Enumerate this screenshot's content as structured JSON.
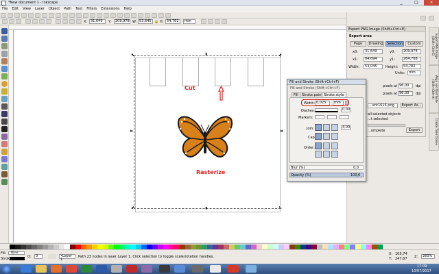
{
  "window": {
    "title": "*New document 1 - Inkscape",
    "minimize": "_",
    "maximize": "□",
    "close": "×"
  },
  "menu": [
    "File",
    "Edit",
    "View",
    "Layer",
    "Object",
    "Path",
    "Text",
    "Filters",
    "Extensions",
    "Help"
  ],
  "controls": {
    "x_label": "X:",
    "x_value": "31,649",
    "y_label": "Y:",
    "y_value": "209,978",
    "w_label": "W:",
    "w_value": "53,645",
    "h_label": "H:",
    "h_value": "54,762",
    "unit": "mm"
  },
  "canvas": {
    "cut_label": "Cut",
    "rasterize_label": "Rasterize",
    "cut_color": "#e02020"
  },
  "export_panel": {
    "title": "Export PNG Image (Shift+Ctrl+E)",
    "area_label": "Export area",
    "buttons": [
      "Page",
      "Drawing",
      "Selection",
      "Custom"
    ],
    "active_button": "Selection",
    "x0_label": "x0:",
    "x0": "31,649",
    "x1_label": "x1:",
    "x1": "84,694",
    "width_label": "Width:",
    "width": "53,045",
    "y0_label": "y0:",
    "y0": "209,978",
    "y1_label": "y1:",
    "y1": "264,768",
    "height_label": "Height:",
    "height": "54,782",
    "units_label": "Units:",
    "units": "mm",
    "dpi_label": "dpi",
    "pixels_at": "pixels at",
    "dpi_value_1": "96,00",
    "dpi_value_2": "96,00",
    "filename": "...ent1616.png",
    "export_as": "Export As...",
    "all_selected": "all selected objects",
    "hide_except": "...t selected",
    "complete": "...omplete",
    "export_button": "Export"
  },
  "fill_stroke": {
    "title": "Fill and Stroke (Shift+Ctrl+F)",
    "subtitle": "Fill and Stroke (Shift+Ctrl+F)",
    "tabs": [
      "Fill",
      "Stroke paint",
      "Stroke style"
    ],
    "active_tab": "Stroke style",
    "width_label": "Width:",
    "width_value": "0,025",
    "width_unit": "mm",
    "dashes_label": "Dashes:",
    "dashes_value": "0,00",
    "markers_label": "Markers:",
    "join_label": "Join:",
    "join_value": "4,00",
    "cap_label": "Cap:",
    "order_label": "Order:",
    "blur_label": "Blur (%)",
    "blur_value": "0,0",
    "opacity_label": "Opacity (%)",
    "opacity_value": "100,0",
    "highlight_color": "#e01010"
  },
  "status": {
    "fill_label": "Fill:",
    "stroke_label": "Stroke:",
    "fill_value": "None",
    "o_label": "O:",
    "o_value": "0",
    "layer": "•Layer 1",
    "message": "Path 23 nodes in layer Layer 1. Click selection to toggle scale/rotation handles.",
    "x_label": "X:",
    "x_coord": "105,74",
    "y_label": "Y:",
    "y_coord": "247,67",
    "z_label": "Z:",
    "zoom": "260%"
  },
  "taskbar": {
    "time": "17:09",
    "date": "10/07/2017"
  },
  "side_tabs": [
    "Export PNG Image (Shift+Ctrl+E)",
    "Align and Distribute (Shift+Ctrl+A)",
    "Create Tiled Clones"
  ],
  "palette_colors": [
    "#000000",
    "#1a1a1a",
    "#333333",
    "#4d4d4d",
    "#666666",
    "#808080",
    "#999999",
    "#b3b3b3",
    "#cccccc",
    "#e6e6e6",
    "#ffffff",
    "#800000",
    "#ff0000",
    "#ff6600",
    "#ff9900",
    "#ffcc00",
    "#ffff00",
    "#ccff00",
    "#66ff00",
    "#00ff00",
    "#00ff66",
    "#00ffcc",
    "#00ffff",
    "#00ccff",
    "#0066ff",
    "#0000ff",
    "#6600ff",
    "#cc00ff",
    "#ff00ff",
    "#ff0099",
    "#ff0066",
    "#993300",
    "#996633",
    "#999933",
    "#669933",
    "#339966",
    "#336699",
    "#663399",
    "#993366",
    "#cc6666",
    "#cccc66",
    "#66cc66",
    "#66cccc",
    "#6666cc",
    "#cc66cc",
    "#ffcccc",
    "#ffffcc",
    "#ccffcc",
    "#ccffff",
    "#ccccff",
    "#ffccff",
    "#804000",
    "#408000",
    "#004080",
    "#400080",
    "#800040",
    "#c0c0c0",
    "#ffe0b0",
    "#b0e0ff",
    "#e0b0ff",
    "#ff8080",
    "#80ff80",
    "#8080ff",
    "#ffff80",
    "#80ffff",
    "#ff80ff",
    "#a05000",
    "#00a050"
  ]
}
